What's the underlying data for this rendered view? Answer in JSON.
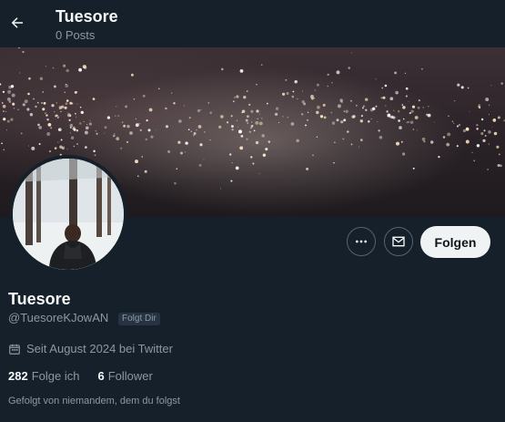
{
  "header": {
    "title": "Tuesore",
    "posts": "0 Posts"
  },
  "profile": {
    "name": "Tuesore",
    "handle": "@TuesoreKJowAN",
    "follows_you": "Folgt Dir",
    "joined": "Seit August 2024 bei Twitter",
    "following_count": "282",
    "following_label": "Folge ich",
    "followers_count": "6",
    "followers_label": "Follower",
    "followed_by": "Gefolgt von niemandem, dem du folgst"
  },
  "actions": {
    "follow_label": "Folgen"
  },
  "icons": {
    "back": "arrow-left-icon",
    "more": "more-icon",
    "message": "envelope-icon",
    "calendar": "calendar-icon"
  },
  "colors": {
    "background": "#15202b",
    "follow_button": "#eff3f4",
    "muted_text": "#8b98a5"
  }
}
